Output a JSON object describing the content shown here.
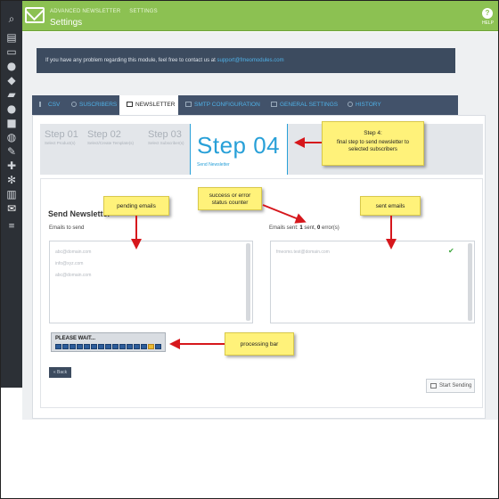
{
  "header": {
    "breadcrumb": [
      "ADVANCED NEWSLETTER",
      "SETTINGS"
    ],
    "title": "Settings",
    "help_label": "HELP"
  },
  "sidebar": {
    "icons": [
      "search-icon",
      "book-icon",
      "card-icon",
      "users-icon",
      "tags-icon",
      "truck-icon",
      "user-icon",
      "globe-icon",
      "wrench-icon",
      "puzzle-icon",
      "gear-icon",
      "chart-icon",
      "mail-icon",
      "menu-icon"
    ]
  },
  "info": {
    "text": "If you have any problem regarding this module, feel free to contact us at ",
    "link": "support@fmeomodules.com"
  },
  "tabs": [
    {
      "label": "CSV",
      "active": false
    },
    {
      "label": "SUSCRIBERS",
      "active": false
    },
    {
      "label": "NEWSLETTER",
      "active": true
    },
    {
      "label": "SMTP CONFIGURATION",
      "active": false
    },
    {
      "label": "GENERAL SETTINGS",
      "active": false
    },
    {
      "label": "HISTORY",
      "active": false
    }
  ],
  "steps": [
    {
      "num": "Step 01",
      "sub": "Select Product(s)"
    },
    {
      "num": "Step 02",
      "sub": "Select/Create Template(s)"
    },
    {
      "num": "Step 03",
      "sub": "Select Subscriber(s)"
    },
    {
      "num": "Step 04",
      "sub": "Send Newsletter"
    }
  ],
  "send": {
    "title": "Send Newsletter",
    "emails_to_send_label": "Emails to send",
    "emails_sent_prefix": "Emails sent: ",
    "sent_count": "1",
    "sent_word": " sent, ",
    "error_count": "0",
    "error_word": " error(s)",
    "pending": [
      "abc@domain.com",
      "info@xyz.com",
      "abc@domain.com"
    ],
    "sent": [
      "fmeomo.test@domain.com"
    ],
    "processing_label": "PLEASE WAIT...",
    "progress_total": 15,
    "progress_active_index": 13,
    "back_label": "« Back",
    "start_label": "Start Sending"
  },
  "notes": {
    "step4": "Step 4:\nfinal step to send newsletter to selected subscribers",
    "pending": "pending emails",
    "counter": "success or error status counter",
    "sent": "sent emails",
    "processing": "processing bar"
  },
  "colors": {
    "header_green": "#8cc152",
    "sidebar_dark": "#2c3036",
    "accent_blue": "#28a0d8",
    "note_yellow": "#fff27a",
    "arrow_red": "#d6171c"
  }
}
